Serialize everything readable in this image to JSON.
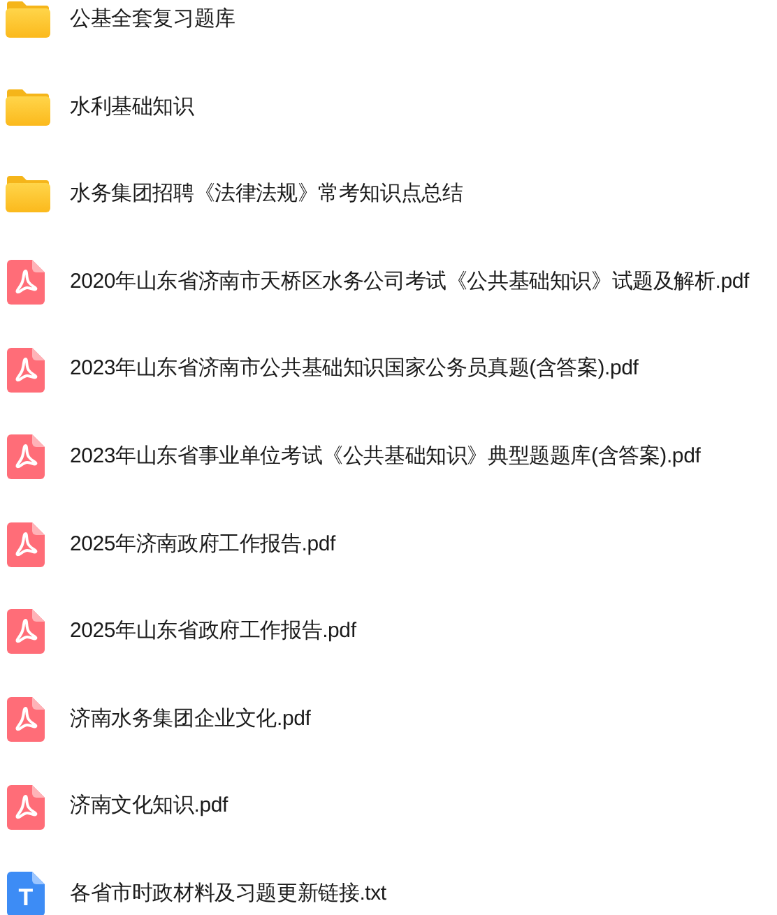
{
  "files": [
    {
      "kind": "folder",
      "name": "公基全套复习题库"
    },
    {
      "kind": "folder",
      "name": "水利基础知识"
    },
    {
      "kind": "folder",
      "name": "水务集团招聘《法律法规》常考知识点总结"
    },
    {
      "kind": "pdf",
      "name": "2020年山东省济南市天桥区水务公司考试《公共基础知识》试题及解析.pdf"
    },
    {
      "kind": "pdf",
      "name": "2023年山东省济南市公共基础知识国家公务员真题(含答案).pdf"
    },
    {
      "kind": "pdf",
      "name": "2023年山东省事业单位考试《公共基础知识》典型题题库(含答案).pdf"
    },
    {
      "kind": "pdf",
      "name": "2025年济南政府工作报告.pdf"
    },
    {
      "kind": "pdf",
      "name": "2025年山东省政府工作报告.pdf"
    },
    {
      "kind": "pdf",
      "name": "济南水务集团企业文化.pdf"
    },
    {
      "kind": "pdf",
      "name": "济南文化知识.pdf"
    },
    {
      "kind": "txt",
      "name": "各省市时政材料及习题更新链接.txt",
      "icon_glyph": "T"
    }
  ]
}
